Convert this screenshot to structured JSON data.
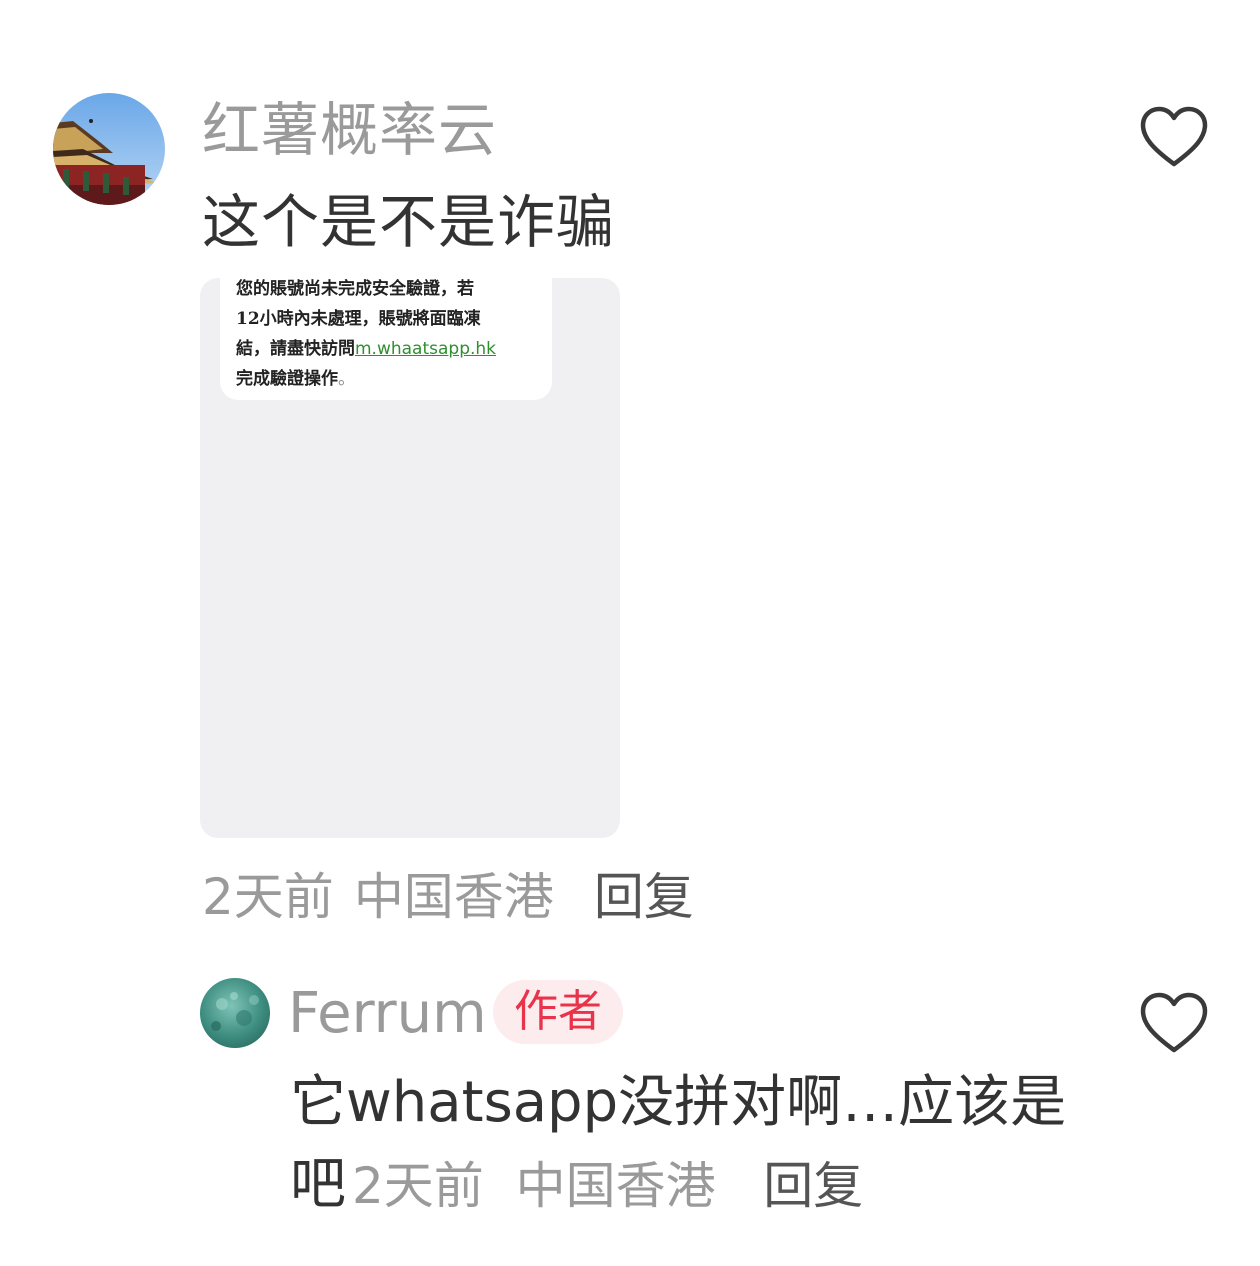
{
  "comments": [
    {
      "avatar_icon": "palace-photo-avatar",
      "username": "红薯概率云",
      "text": "这个是不是诈骗",
      "attachment": {
        "line1": "您的賬號尚未完成安全驗證，若",
        "line2": "12小時內未處理，賬號將面臨凍",
        "line3_pre": "結，請盡快訪問",
        "link": "m.whaatsapp.hk",
        "line4": "完成驗證操作",
        "line4_end": "。"
      },
      "time": "2天前",
      "location": "中国香港",
      "reply_label": "回复",
      "like_icon": "heart-outline-icon"
    },
    {
      "avatar_icon": "teal-texture-avatar",
      "username": "Ferrum",
      "badge": "作者",
      "text": "它whatsapp没拼对啊…应该是吧",
      "time": "2天前",
      "location": "中国香港",
      "reply_label": "回复",
      "like_icon": "heart-outline-icon"
    }
  ],
  "colors": {
    "username": "#9a9a9a",
    "text": "#333333",
    "badge_text": "#e8334a",
    "badge_bg": "#fdecee",
    "link": "#2e8f2e"
  }
}
